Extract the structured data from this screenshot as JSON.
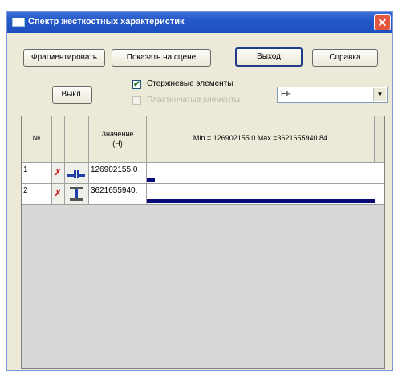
{
  "window": {
    "title": "Спектр жесткостных характеристик",
    "close_glyph": "✕"
  },
  "toolbar": {
    "fragment_label": "Фрагментировать",
    "show_on_scene_label": "Показать на сцене",
    "exit_label": "Выход",
    "help_label": "Справка"
  },
  "controls": {
    "off_button_label": "Выкл.",
    "rod_elements": {
      "label": "Стержневые элементы",
      "checked": true,
      "mark": "✔"
    },
    "plate_elements": {
      "label": "Пластинчатые элементы",
      "checked": false,
      "disabled": true
    },
    "parameter_select": {
      "value": "EF",
      "arrow": "▼"
    }
  },
  "table": {
    "headers": {
      "number": "№",
      "value_line1": "Значение",
      "value_line2": "(Н)",
      "range": "Min = 126902155.0 Max =3621655940.84"
    },
    "min": 126902155.0,
    "max": 3621655940.84,
    "rows": [
      {
        "number": "1",
        "mark": "✗",
        "icon": "channel-section-icon",
        "value_text": "126902155.0",
        "value": 126902155.0
      },
      {
        "number": "2",
        "mark": "✗",
        "icon": "i-beam-section-icon",
        "value_text": "3621655940.",
        "value": 3621655940.84
      }
    ]
  }
}
